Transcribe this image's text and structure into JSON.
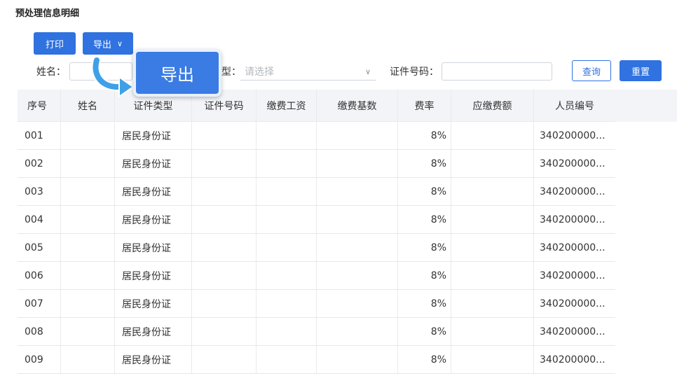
{
  "page": {
    "title": "预处理信息明细"
  },
  "toolbar": {
    "print_label": "打印",
    "export_label": "导出"
  },
  "popup": {
    "label": "导出"
  },
  "filters": {
    "name_label": "姓名：",
    "type_label_partial": "型：",
    "type_placeholder": "请选择",
    "id_label": "证件号码："
  },
  "actions": {
    "query_label": "查询",
    "reset_label": "重置"
  },
  "table": {
    "columns": [
      "序号",
      "姓名",
      "证件类型",
      "证件号码",
      "缴费工资",
      "缴费基数",
      "费率",
      "应缴费额",
      "人员编号"
    ],
    "rows": [
      {
        "seq": "001",
        "name": "",
        "id_type": "居民身份证",
        "id_no": "",
        "wage": "",
        "base": "",
        "rate": "8%",
        "amount": "",
        "person_no": "340200000..."
      },
      {
        "seq": "002",
        "name": "",
        "id_type": "居民身份证",
        "id_no": "",
        "wage": "",
        "base": "",
        "rate": "8%",
        "amount": "",
        "person_no": "340200000..."
      },
      {
        "seq": "003",
        "name": "",
        "id_type": "居民身份证",
        "id_no": "",
        "wage": "",
        "base": "",
        "rate": "8%",
        "amount": "",
        "person_no": "340200000..."
      },
      {
        "seq": "004",
        "name": "",
        "id_type": "居民身份证",
        "id_no": "",
        "wage": "",
        "base": "",
        "rate": "8%",
        "amount": "",
        "person_no": "340200000..."
      },
      {
        "seq": "005",
        "name": "",
        "id_type": "居民身份证",
        "id_no": "",
        "wage": "",
        "base": "",
        "rate": "8%",
        "amount": "",
        "person_no": "340200000..."
      },
      {
        "seq": "006",
        "name": "",
        "id_type": "居民身份证",
        "id_no": "",
        "wage": "",
        "base": "",
        "rate": "8%",
        "amount": "",
        "person_no": "340200000..."
      },
      {
        "seq": "007",
        "name": "",
        "id_type": "居民身份证",
        "id_no": "",
        "wage": "",
        "base": "",
        "rate": "8%",
        "amount": "",
        "person_no": "340200000..."
      },
      {
        "seq": "008",
        "name": "",
        "id_type": "居民身份证",
        "id_no": "",
        "wage": "",
        "base": "",
        "rate": "8%",
        "amount": "",
        "person_no": "340200000..."
      },
      {
        "seq": "009",
        "name": "",
        "id_type": "居民身份证",
        "id_no": "",
        "wage": "",
        "base": "",
        "rate": "8%",
        "amount": "",
        "person_no": "340200000..."
      }
    ]
  },
  "icons": {
    "export_dropdown": "chevron-down-icon",
    "select_dropdown": "chevron-down-icon",
    "callout_arrow": "curved-arrow-icon"
  },
  "colors": {
    "primary": "#2f72e0",
    "header_bg": "#f2f4f7",
    "callout_bg": "#3a7be4"
  }
}
